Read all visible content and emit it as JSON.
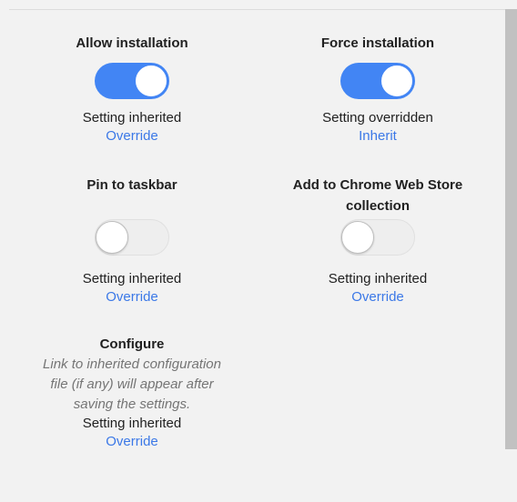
{
  "settings": {
    "allow_installation": {
      "title": "Allow installation",
      "enabled": true,
      "status": "Setting inherited",
      "action": "Override"
    },
    "force_installation": {
      "title": "Force installation",
      "enabled": true,
      "status": "Setting overridden",
      "action": "Inherit"
    },
    "pin_to_taskbar": {
      "title": "Pin to taskbar",
      "enabled": false,
      "status": "Setting inherited",
      "action": "Override"
    },
    "add_to_cws_collection": {
      "title_line1": "Add to Chrome Web Store",
      "title_line2": "collection",
      "enabled": false,
      "status": "Setting inherited",
      "action": "Override"
    },
    "configure": {
      "title": "Configure",
      "description_lines": [
        "Link to inherited configuration",
        "file (if any) will appear after",
        "saving the settings."
      ],
      "status": "Setting inherited",
      "action": "Override"
    }
  },
  "colors": {
    "accent": "#4285f4",
    "link": "#3b78e7",
    "background": "#f2f2f2"
  }
}
